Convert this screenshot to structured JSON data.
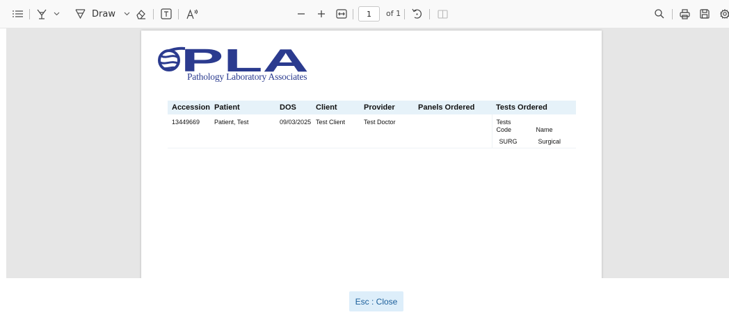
{
  "toolbar": {
    "draw_label": "Draw",
    "page_number": "1",
    "page_of": "of 1"
  },
  "document": {
    "logo_text": "PLA",
    "logo_subtitle": "Pathology Laboratory Associates",
    "columns": [
      "Accession",
      "Patient",
      "DOS",
      "Client",
      "Provider",
      "Panels Ordered",
      "Tests Ordered"
    ],
    "row": {
      "accession": "13449669",
      "patient": "Patient, Test",
      "dos": "09/03/2025",
      "client": "Test Client",
      "provider": "Test Doctor",
      "panels": "",
      "tests_title": "Tests",
      "tests_code_header": "Code",
      "tests_name_header": "Name",
      "tests": [
        {
          "code": "SURG",
          "name": "Surgical"
        }
      ]
    }
  },
  "footer": {
    "close_label": "Esc : Close"
  },
  "colors": {
    "logo_blue": "#2b3b8f",
    "header_bg": "#e6f2f9",
    "button_bg": "#ddeefa",
    "button_text": "#1a5e9a"
  }
}
